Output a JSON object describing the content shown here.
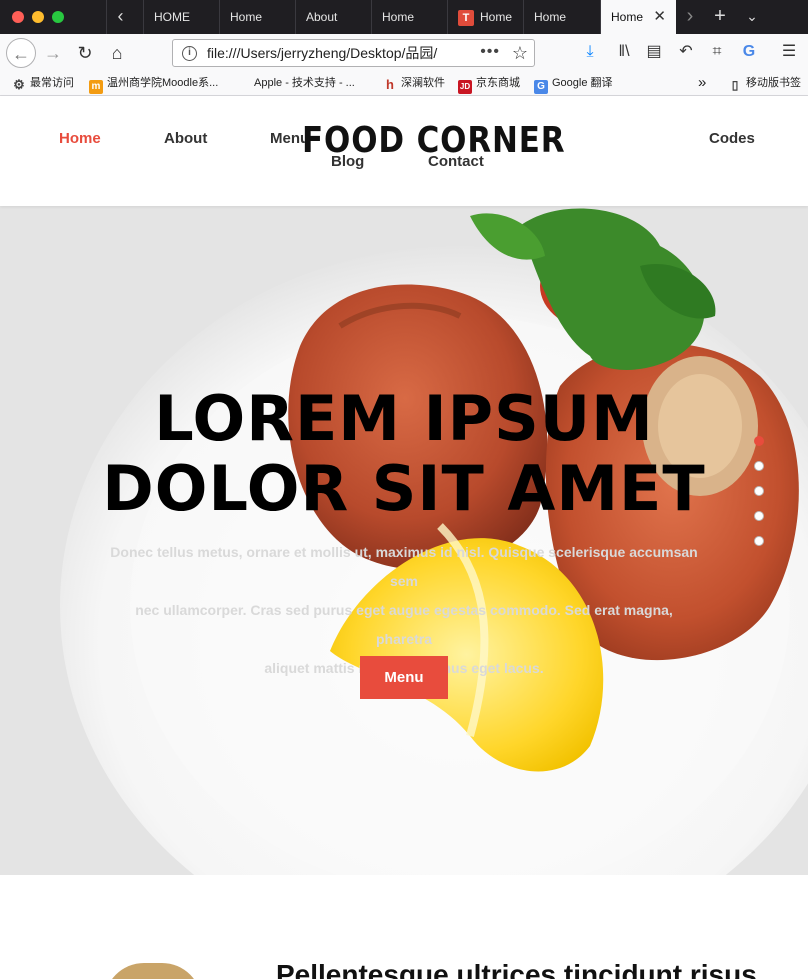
{
  "browser": {
    "tabs": [
      {
        "label": "HOME"
      },
      {
        "label": "Home"
      },
      {
        "label": "About"
      },
      {
        "label": "Home"
      },
      {
        "label": "Home"
      },
      {
        "label": "Home"
      },
      {
        "label": "Home",
        "active": true
      }
    ],
    "url": "file:///Users/jerryzheng/Desktop/品园/",
    "more_dots": "•••",
    "bookmarks": [
      {
        "label": "最常访问",
        "icon": "gear-icon"
      },
      {
        "label": "温州商学院Moodle系...",
        "icon": "moodle-icon"
      },
      {
        "label": "Apple - 技术支持 - ...",
        "icon": "apple-icon"
      },
      {
        "label": "深澜软件",
        "icon": "h-icon"
      },
      {
        "label": "京东商城",
        "icon": "jd-icon"
      },
      {
        "label": "Google 翻译",
        "icon": "google-translate-icon"
      }
    ],
    "mobile_bookmarks": "移动版书签"
  },
  "site": {
    "brand": "FOOD CORNER",
    "nav": {
      "home": "Home",
      "about": "About",
      "menu": "Menu",
      "blog": "Blog",
      "contact": "Contact",
      "codes": "Codes"
    },
    "accent_color": "#e84c3d"
  },
  "hero": {
    "title_line1": "LOREM IPSUM",
    "title_line2": "DOLOR SIT AMET",
    "text_line1": "Donec tellus metus, ornare et mollis ut, maximus id nisl. Quisque scelerisque accumsan sem",
    "text_line2": "nec ullamcorper. Cras sed purus eget augue egestas commodo. Sed erat magna, pharetra",
    "text_line3": "aliquet mattis mollis, maximus eget lacus.",
    "button": "Menu",
    "slides": 5,
    "active_slide": 1
  },
  "section": {
    "heading": "Pellentesque ultrices tincidunt risus"
  }
}
